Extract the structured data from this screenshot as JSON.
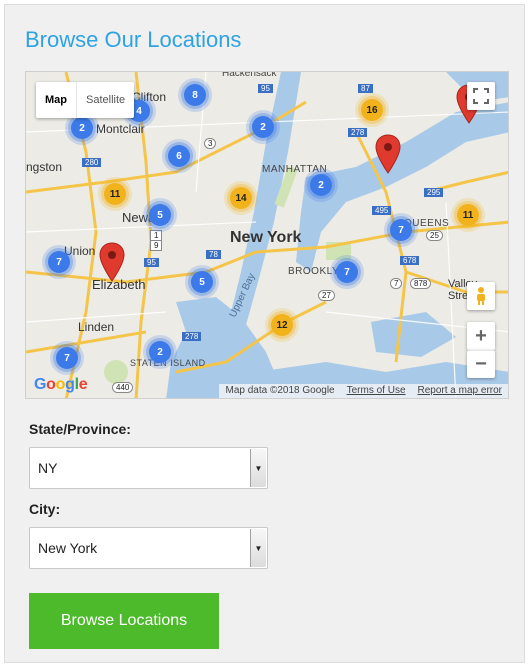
{
  "heading": "Browse Our Locations",
  "map": {
    "type_controls": {
      "map": "Map",
      "satellite": "Satellite"
    },
    "attribution": {
      "data": "Map data ©2018 Google",
      "terms": "Terms of Use",
      "report": "Report a map error"
    },
    "labels": {
      "city": "New York",
      "neighborhoods": [
        "Clifton",
        "Montclair",
        "Newark",
        "Union",
        "Elizabeth",
        "Linden",
        "MANHATTAN",
        "BROOKLYN",
        "QUEENS",
        "Valley Stream",
        "STATEN ISLAND",
        "Upper Bay",
        "Hackensack",
        "ngston"
      ],
      "routes": [
        "3",
        "95",
        "87",
        "280",
        "278",
        "9",
        "95",
        "78",
        "1",
        "678",
        "295",
        "495",
        "27",
        "878",
        "7",
        "25",
        "440",
        "278"
      ]
    },
    "clusters": [
      {
        "count": "4",
        "color": "blue"
      },
      {
        "count": "8",
        "color": "blue"
      },
      {
        "count": "2",
        "color": "blue"
      },
      {
        "count": "6",
        "color": "blue"
      },
      {
        "count": "2",
        "color": "blue"
      },
      {
        "count": "16",
        "color": "yellow"
      },
      {
        "count": "11",
        "color": "yellow"
      },
      {
        "count": "14",
        "color": "yellow"
      },
      {
        "count": "5",
        "color": "blue"
      },
      {
        "count": "2",
        "color": "blue"
      },
      {
        "count": "7",
        "color": "blue"
      },
      {
        "count": "11",
        "color": "yellow"
      },
      {
        "count": "7",
        "color": "blue"
      },
      {
        "count": "5",
        "color": "blue"
      },
      {
        "count": "7",
        "color": "blue"
      },
      {
        "count": "12",
        "color": "yellow"
      },
      {
        "count": "2",
        "color": "blue"
      },
      {
        "count": "7",
        "color": "blue"
      }
    ],
    "pins": [
      "pin",
      "pin",
      "pin"
    ],
    "colors": {
      "blue_cluster": "#3b7ae8",
      "yellow_cluster": "#f2b21c",
      "pin": "#e03a2f",
      "water": "#a9c9e8",
      "land": "#ecebe5",
      "highway": "#f5c54a"
    }
  },
  "state_field": {
    "label": "State/Province:",
    "value": "NY"
  },
  "city_field": {
    "label": "City:",
    "value": "New York"
  },
  "browse_button": "Browse Locations"
}
